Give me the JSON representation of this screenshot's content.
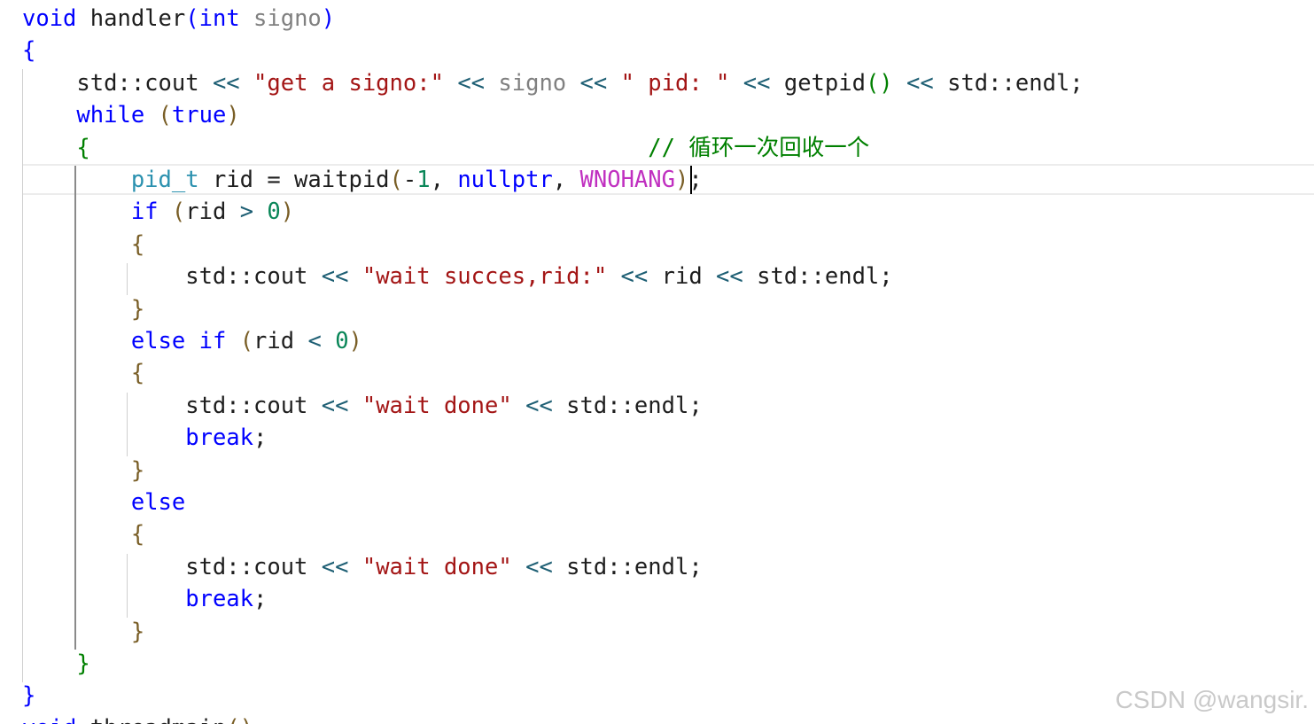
{
  "colors": {
    "keyword": "#0000ff",
    "type": "#2b91af",
    "string": "#a31515",
    "number": "#098658",
    "macro": "#c030c0",
    "parameter": "#808080",
    "function": "#1e1e1e",
    "operator": "#1e5f74",
    "comment": "#008000",
    "brace_outer": "#0000ff",
    "brace_while": "#008000",
    "brace_inner": "#795e26",
    "plain": "#1e1e1e"
  },
  "code": {
    "lines": [
      [
        [
          "void",
          "keyword"
        ],
        [
          " handler",
          "function"
        ],
        [
          "(",
          "brace_outer"
        ],
        [
          "int",
          "keyword"
        ],
        [
          " signo",
          "parameter"
        ],
        [
          ")",
          "brace_outer"
        ]
      ],
      [
        [
          "{",
          "brace_outer"
        ]
      ],
      [
        [
          "    std::cout ",
          "plain"
        ],
        [
          "<<",
          "operator"
        ],
        [
          " ",
          "plain"
        ],
        [
          "\"get a signo:\"",
          "string"
        ],
        [
          " ",
          "plain"
        ],
        [
          "<<",
          "operator"
        ],
        [
          " signo ",
          "parameter"
        ],
        [
          "<<",
          "operator"
        ],
        [
          " ",
          "plain"
        ],
        [
          "\" pid: \"",
          "string"
        ],
        [
          " ",
          "plain"
        ],
        [
          "<<",
          "operator"
        ],
        [
          " getpid",
          "function"
        ],
        [
          "()",
          "brace_while"
        ],
        [
          " ",
          "plain"
        ],
        [
          "<<",
          "operator"
        ],
        [
          " std::endl;",
          "plain"
        ]
      ],
      [
        [
          "    ",
          "plain"
        ],
        [
          "while",
          "keyword"
        ],
        [
          " ",
          "plain"
        ],
        [
          "(",
          "brace_inner"
        ],
        [
          "true",
          "keyword"
        ],
        [
          ")",
          "brace_inner"
        ]
      ],
      [
        [
          "    ",
          "plain"
        ],
        [
          "{",
          "brace_while"
        ],
        [
          "                                         // ",
          "comment"
        ],
        [
          "循环一次回收一个",
          "comment"
        ]
      ],
      [
        [
          "        ",
          "plain"
        ],
        [
          "pid_t",
          "type"
        ],
        [
          " rid = waitpid",
          "plain"
        ],
        [
          "(",
          "brace_inner"
        ],
        [
          "-",
          "plain"
        ],
        [
          "1",
          "number"
        ],
        [
          ", ",
          "plain"
        ],
        [
          "nullptr",
          "keyword"
        ],
        [
          ", ",
          "plain"
        ],
        [
          "WNOHANG",
          "macro"
        ],
        [
          ")",
          "brace_inner"
        ],
        [
          ";",
          "plain"
        ]
      ],
      [
        [
          "        ",
          "plain"
        ],
        [
          "if",
          "keyword"
        ],
        [
          " ",
          "plain"
        ],
        [
          "(",
          "brace_inner"
        ],
        [
          "rid ",
          "plain"
        ],
        [
          ">",
          "operator"
        ],
        [
          " ",
          "plain"
        ],
        [
          "0",
          "number"
        ],
        [
          ")",
          "brace_inner"
        ]
      ],
      [
        [
          "        ",
          "plain"
        ],
        [
          "{",
          "brace_inner"
        ]
      ],
      [
        [
          "            std::cout ",
          "plain"
        ],
        [
          "<<",
          "operator"
        ],
        [
          " ",
          "plain"
        ],
        [
          "\"wait succes,rid:\"",
          "string"
        ],
        [
          " ",
          "plain"
        ],
        [
          "<<",
          "operator"
        ],
        [
          " rid ",
          "plain"
        ],
        [
          "<<",
          "operator"
        ],
        [
          " std::endl;",
          "plain"
        ]
      ],
      [
        [
          "        ",
          "plain"
        ],
        [
          "}",
          "brace_inner"
        ]
      ],
      [
        [
          "        ",
          "plain"
        ],
        [
          "else",
          "keyword"
        ],
        [
          " ",
          "plain"
        ],
        [
          "if",
          "keyword"
        ],
        [
          " ",
          "plain"
        ],
        [
          "(",
          "brace_inner"
        ],
        [
          "rid ",
          "plain"
        ],
        [
          "<",
          "operator"
        ],
        [
          " ",
          "plain"
        ],
        [
          "0",
          "number"
        ],
        [
          ")",
          "brace_inner"
        ]
      ],
      [
        [
          "        ",
          "plain"
        ],
        [
          "{",
          "brace_inner"
        ]
      ],
      [
        [
          "            std::cout ",
          "plain"
        ],
        [
          "<<",
          "operator"
        ],
        [
          " ",
          "plain"
        ],
        [
          "\"wait done\"",
          "string"
        ],
        [
          " ",
          "plain"
        ],
        [
          "<<",
          "operator"
        ],
        [
          " std::endl;",
          "plain"
        ]
      ],
      [
        [
          "            ",
          "plain"
        ],
        [
          "break",
          "keyword"
        ],
        [
          ";",
          "plain"
        ]
      ],
      [
        [
          "        ",
          "plain"
        ],
        [
          "}",
          "brace_inner"
        ]
      ],
      [
        [
          "        ",
          "plain"
        ],
        [
          "else",
          "keyword"
        ]
      ],
      [
        [
          "        ",
          "plain"
        ],
        [
          "{",
          "brace_inner"
        ]
      ],
      [
        [
          "            std::cout ",
          "plain"
        ],
        [
          "<<",
          "operator"
        ],
        [
          " ",
          "plain"
        ],
        [
          "\"wait done\"",
          "string"
        ],
        [
          " ",
          "plain"
        ],
        [
          "<<",
          "operator"
        ],
        [
          " std::endl;",
          "plain"
        ]
      ],
      [
        [
          "            ",
          "plain"
        ],
        [
          "break",
          "keyword"
        ],
        [
          ";",
          "plain"
        ]
      ],
      [
        [
          "        ",
          "plain"
        ],
        [
          "}",
          "brace_inner"
        ]
      ],
      [
        [
          "    ",
          "plain"
        ],
        [
          "}",
          "brace_while"
        ]
      ],
      [
        [
          "}",
          "brace_outer"
        ]
      ],
      [
        [
          "void",
          "keyword"
        ],
        [
          " threadmain",
          "function"
        ],
        [
          "()",
          "brace_inner"
        ]
      ]
    ]
  },
  "watermark": {
    "text": "CSDN @wangsir."
  }
}
